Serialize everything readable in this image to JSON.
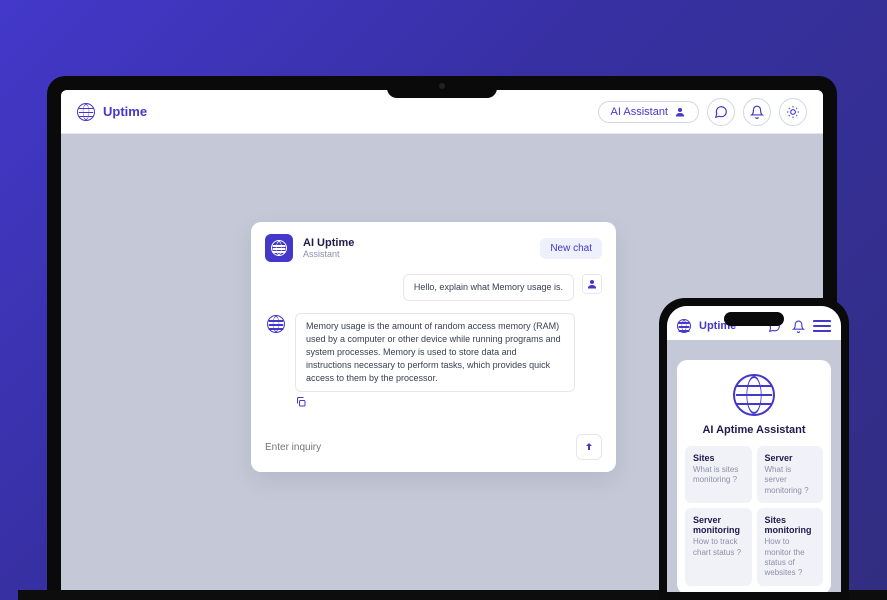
{
  "brand": {
    "name": "Uptime"
  },
  "header": {
    "ai_pill_label": "AI Assistant"
  },
  "chat": {
    "title": "AI Uptime",
    "subtitle": "Assistant",
    "new_chat_label": "New chat",
    "user_message": "Hello, explain what Memory usage is.",
    "ai_message": "Memory usage is the amount of random access memory (RAM) used by a computer or other device while running programs and system processes. Memory is used to store data and instructions necessary to perform tasks, which provides quick access to them by the processor.",
    "input_placeholder": "Enter inquiry"
  },
  "mobile": {
    "title": "AI Aptime Assistant",
    "topics": [
      {
        "title": "Sites",
        "sub": "What is sites monitoring ?"
      },
      {
        "title": "Server",
        "sub": "What is server monitoring ?"
      },
      {
        "title": "Server monitoring",
        "sub": "How to track chart status ?"
      },
      {
        "title": "Sites monitoring",
        "sub": "How to monitor the status of websites ?"
      }
    ]
  }
}
